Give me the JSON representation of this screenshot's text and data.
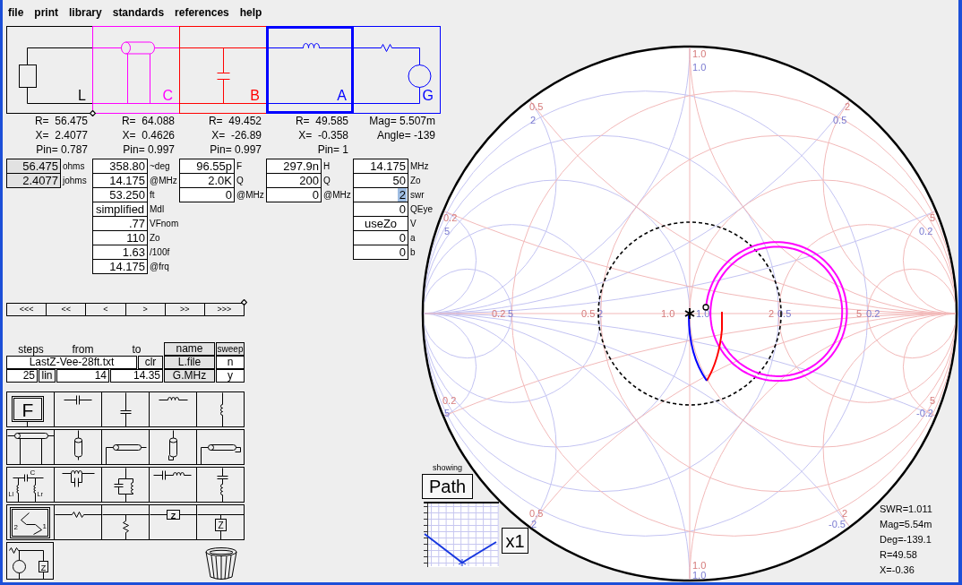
{
  "menu_bar": [
    "file",
    "print",
    "library",
    "standards",
    "references",
    "help"
  ],
  "circuit": {
    "stages": [
      {
        "kind": "load",
        "label": "L",
        "color": "#000000",
        "selected": false
      },
      {
        "kind": "coax",
        "label": "C",
        "color": "#ff00ff",
        "selected": false
      },
      {
        "kind": "shunt_capacitor",
        "label": "B",
        "color": "#ff0000",
        "selected": false
      },
      {
        "kind": "series_inductor",
        "label": "A",
        "color": "#0000ff",
        "selected": true
      },
      {
        "kind": "generator",
        "label": "G",
        "color": "#0000ff",
        "selected": false
      }
    ]
  },
  "stage_columns": [
    {
      "readouts": [
        "R=  56.475",
        "X=  2.4077",
        "Pin= 0.787"
      ],
      "read_only": true,
      "fields": [
        {
          "value": "56.475",
          "unit": "ohms"
        },
        {
          "value": "2.4077",
          "unit": "johms"
        }
      ]
    },
    {
      "readouts": [
        "R=  64.088",
        "X=  0.4626",
        "Pin= 0.997"
      ],
      "read_only": false,
      "fields": [
        {
          "kind": "number",
          "value": "358.80",
          "unit": "~deg"
        },
        {
          "kind": "number",
          "value": "14.175",
          "unit": "@MHz"
        },
        {
          "kind": "number",
          "value": "53.250",
          "unit": "ft"
        },
        {
          "kind": "choice",
          "value": "simplified",
          "unit": "Mdl"
        },
        {
          "kind": "number",
          "value": ".77",
          "unit": "VFnom"
        },
        {
          "kind": "number",
          "value": "110",
          "unit": "Zo"
        },
        {
          "kind": "number",
          "value": "1.63",
          "unit": "/100f"
        },
        {
          "kind": "number",
          "value": "14.175",
          "unit": "@frq"
        }
      ]
    },
    {
      "readouts": [
        "R=  49.452",
        "X=  -26.89",
        "Pin= 0.997"
      ],
      "read_only": false,
      "fields": [
        {
          "value": "96.55p",
          "unit": "F"
        },
        {
          "value": "2.0K",
          "unit": "Q"
        },
        {
          "value": "0",
          "unit": "@MHz"
        }
      ]
    },
    {
      "readouts": [
        "R=  49.585",
        "X=  -0.358",
        "Pin= 1"
      ],
      "read_only": false,
      "fields": [
        {
          "value": "297.9n",
          "unit": "H"
        },
        {
          "value": "200",
          "unit": "Q"
        },
        {
          "value": "0",
          "unit": "@MHz"
        }
      ]
    },
    {
      "readouts": [
        "Mag= 5.507m",
        "Angle= -139"
      ],
      "read_only": false,
      "fields": [
        {
          "kind": "number",
          "value": "14.175",
          "unit": "MHz",
          "highlighted": false
        },
        {
          "kind": "number",
          "value": "50",
          "unit": "Zo",
          "highlighted": false
        },
        {
          "kind": "number",
          "value": "2",
          "unit": "swr",
          "highlighted": true
        },
        {
          "kind": "number",
          "value": "0",
          "unit": "QEye",
          "highlighted": false
        },
        {
          "kind": "choice",
          "value": "useZo",
          "unit": "V",
          "highlighted": false
        },
        {
          "kind": "number",
          "value": "0",
          "unit": "a",
          "highlighted": false
        },
        {
          "kind": "number",
          "value": "0",
          "unit": "b",
          "highlighted": false
        }
      ]
    }
  ],
  "step_buttons": [
    "<<<",
    "<<",
    "<",
    ">",
    ">>",
    ">>>"
  ],
  "sweep": {
    "headers": [
      "steps",
      "from",
      "to"
    ],
    "name_header": "name",
    "sweep_header": "sweep",
    "file": "LastZ-Vee-28ft.txt",
    "clear_button": "clr",
    "steps": "25",
    "scale": "lin",
    "from": "14",
    "to": "14.35",
    "rows": [
      {
        "name": "L.file",
        "sweep": "n"
      },
      {
        "name": "G.MHz",
        "sweep": "y"
      }
    ]
  },
  "palette": [
    {
      "kind": "fixture",
      "labels": [
        "F"
      ]
    },
    {
      "kind": "series_capacitor"
    },
    {
      "kind": "shunt_capacitor"
    },
    {
      "kind": "series_inductor"
    },
    {
      "kind": "shunt_inductor"
    },
    {
      "kind": "coax_line"
    },
    {
      "kind": "shunt_stub_open"
    },
    {
      "kind": "series_stub_open"
    },
    {
      "kind": "shunt_stub_shorted"
    },
    {
      "kind": "series_stub_shorted"
    },
    {
      "kind": "trap",
      "labels": [
        "C",
        "Ll",
        "Lr"
      ]
    },
    {
      "kind": "parallel_lc"
    },
    {
      "kind": "shunt_lc"
    },
    {
      "kind": "series_lc"
    },
    {
      "kind": "shunt_series_lc"
    },
    {
      "kind": "two_port",
      "labels": [
        "2",
        "1"
      ]
    },
    {
      "kind": "series_resistor"
    },
    {
      "kind": "shunt_resistor"
    },
    {
      "kind": "series_impedance",
      "labels": [
        "Z"
      ]
    },
    {
      "kind": "shunt_impedance",
      "labels": [
        "Z"
      ]
    },
    {
      "kind": "source",
      "labels": [
        "Z"
      ]
    }
  ],
  "smith_chart": {
    "grid_labels": [
      {
        "text": "1.0",
        "kind": "impedance"
      },
      {
        "text": "1.0",
        "kind": "admittance"
      },
      {
        "text": "0.5",
        "kind": "impedance"
      },
      {
        "text": "2",
        "kind": "admittance"
      },
      {
        "text": "2",
        "kind": "impedance"
      },
      {
        "text": "0.5",
        "kind": "admittance"
      },
      {
        "text": "0.2",
        "kind": "impedance"
      },
      {
        "text": "5",
        "kind": "admittance"
      },
      {
        "text": "5",
        "kind": "impedance"
      },
      {
        "text": "0.2",
        "kind": "admittance"
      },
      {
        "text": "0.2",
        "kind": "impedance"
      },
      {
        "text": "5",
        "kind": "admittance"
      },
      {
        "text": "0.5",
        "kind": "impedance"
      },
      {
        "text": "2",
        "kind": "admittance"
      },
      {
        "text": "1.0",
        "kind": "impedance"
      },
      {
        "text": "1.0",
        "kind": "admittance"
      },
      {
        "text": "2",
        "kind": "impedance"
      },
      {
        "text": "0.5",
        "kind": "admittance"
      },
      {
        "text": "5",
        "kind": "impedance"
      },
      {
        "text": "0.2",
        "kind": "admittance"
      },
      {
        "text": "0.2",
        "kind": "impedance"
      },
      {
        "text": "5",
        "kind": "admittance"
      },
      {
        "text": "5",
        "kind": "impedance"
      },
      {
        "text": "-0.2",
        "kind": "admittance"
      },
      {
        "text": "0.5",
        "kind": "impedance"
      },
      {
        "text": "2",
        "kind": "admittance"
      },
      {
        "text": "2",
        "kind": "impedance"
      },
      {
        "text": "-0.5",
        "kind": "admittance"
      },
      {
        "text": "1.0",
        "kind": "impedance"
      },
      {
        "text": "1.0",
        "kind": "admittance"
      }
    ]
  },
  "view": {
    "caption": "showing",
    "mode_button": "Path",
    "scale_button": "x1"
  },
  "readout": [
    "SWR=1.011",
    "Mag=5.54m",
    "Deg=-139.1",
    "R=49.58",
    "X=-0.36"
  ]
}
